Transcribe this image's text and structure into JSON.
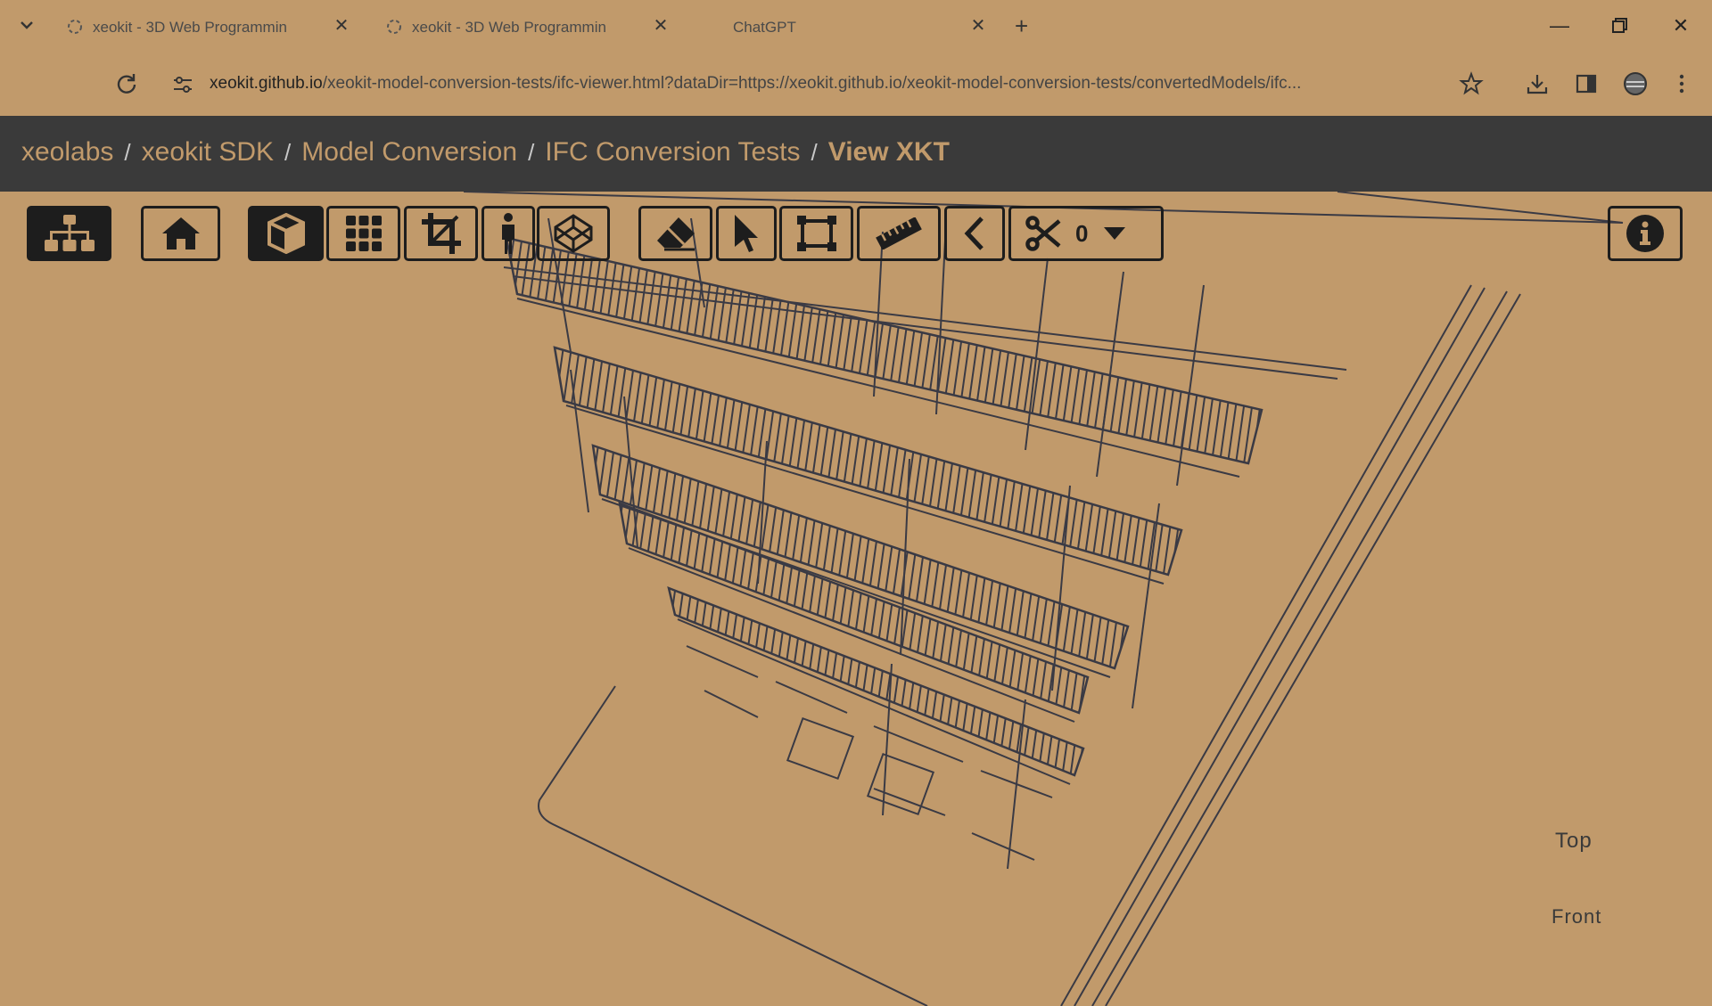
{
  "browser": {
    "tabs": [
      {
        "title": "xeokit - 3D Web Programmin",
        "active": false
      },
      {
        "title": "xeokit - 3D Web Programmin",
        "active": true
      },
      {
        "title": "ChatGPT",
        "active": false
      }
    ],
    "url": {
      "host": "xeokit.github.io",
      "path": "/xeokit-model-conversion-tests/ifc-viewer.html?dataDir=https://xeokit.github.io/xeokit-model-conversion-tests/convertedModels/ifc..."
    }
  },
  "breadcrumb": {
    "items": [
      "xeolabs",
      "xeokit SDK",
      "Model Conversion",
      "IFC Conversion Tests"
    ],
    "current": "View XKT",
    "separator": "/"
  },
  "toolbar": {
    "section_count": "0",
    "buttons": [
      {
        "name": "explorer",
        "icon": "sitemap-icon",
        "active": true
      },
      {
        "name": "reset-view",
        "icon": "home-icon",
        "active": false
      },
      {
        "name": "3d-mode",
        "icon": "cube-icon",
        "active": true
      },
      {
        "name": "ortho-mode",
        "icon": "grid-icon",
        "active": false
      },
      {
        "name": "fit-view",
        "icon": "crop-icon",
        "active": false
      },
      {
        "name": "first-person",
        "icon": "person-icon",
        "active": false
      },
      {
        "name": "xray",
        "icon": "codepen-icon",
        "active": false
      },
      {
        "name": "hide",
        "icon": "eraser-icon",
        "active": false
      },
      {
        "name": "select",
        "icon": "cursor-icon",
        "active": false
      },
      {
        "name": "marquee",
        "icon": "marquee-icon",
        "active": false
      },
      {
        "name": "measure",
        "icon": "ruler-icon",
        "active": false
      },
      {
        "name": "measure-angle",
        "icon": "angle-icon",
        "active": false
      },
      {
        "name": "section",
        "icon": "scissors-icon",
        "active": false
      }
    ]
  },
  "navcube": {
    "top": "Top",
    "front": "Front"
  },
  "colors": {
    "background": "#c19a6b",
    "header": "#3a3a3a",
    "ink": "#1d1d1d"
  }
}
